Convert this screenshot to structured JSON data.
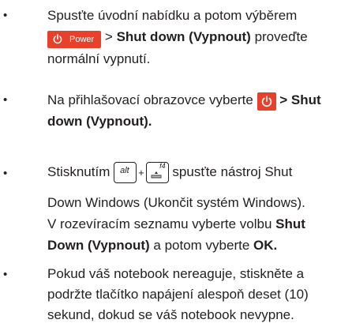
{
  "bullet": "•",
  "item1": {
    "text_a": "Spusťte úvodní nabídku a potom výběrem",
    "power_label": "Power",
    "sep": " > ",
    "bold": "Shut down (Vypnout)",
    "text_b": " proveďte",
    "text_c": "normální vypnutí."
  },
  "item2": {
    "text_a": "Na přihlašovací obrazovce vyberte ",
    "bold": " > Shut",
    "bold_b": "down (Vypnout)."
  },
  "item3": {
    "text_a": "Stisknutím ",
    "key_alt": "alt",
    "plus": "+",
    "key_f4": "f4",
    "text_b": " spusťte nástroj Shut",
    "line2": "Down Windows (Ukončit systém Windows).",
    "line3_a": "V rozevíracím seznamu vyberte volbu ",
    "line3_bold": "Shut",
    "line4_bold": "Down (Vypnout)",
    "line4_b": " a potom vyberte ",
    "line4_bold2": "OK."
  },
  "item4": {
    "line1": "Pokud váš notebook nereaguje, stiskněte a",
    "line2": "podržte tlačítko napájení alespoň deset (10)",
    "line3": "sekund, dokud se váš notebook nevypne."
  }
}
